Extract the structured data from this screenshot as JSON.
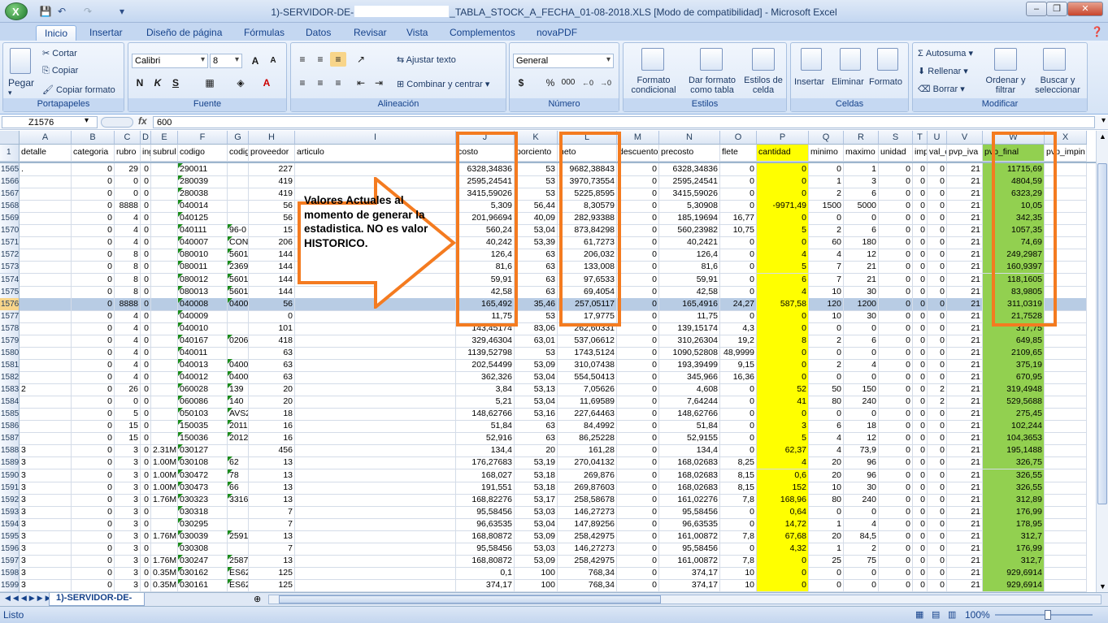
{
  "window": {
    "title_prefix": "1)-SERVIDOR-DE-",
    "title_suffix": "_TABLA_STOCK_A_FECHA_01-08-2018.XLS  [Modo de compatibilidad] - Microsoft Excel",
    "logo_letter": "X"
  },
  "ribbon_tabs": [
    "Inicio",
    "Insertar",
    "Diseño de página",
    "Fórmulas",
    "Datos",
    "Revisar",
    "Vista",
    "Complementos",
    "novaPDF"
  ],
  "ribbon": {
    "paste": "Pegar",
    "cut": "Cortar",
    "copy": "Copiar",
    "copy_format": "Copiar formato",
    "clipboard": "Portapapeles",
    "font_name": "Calibri",
    "font_size": "8",
    "font_group": "Fuente",
    "bold": "N",
    "italic": "K",
    "underline": "S",
    "align_group": "Alineación",
    "wrap_text": "Ajustar texto",
    "merge_center": "Combinar y centrar",
    "number_format": "General",
    "number_group": "Número",
    "currency": "$",
    "percent": "%",
    "thousands": "000",
    "cond_format": "Formato condicional",
    "table_format": "Dar formato como tabla",
    "cell_styles": "Estilos de celda",
    "styles_group": "Estilos",
    "insert": "Insertar",
    "delete": "Eliminar",
    "format": "Formato",
    "cells_group": "Celdas",
    "autosum": "Autosuma",
    "fill": "Rellenar",
    "clear": "Borrar",
    "sort_filter": "Ordenar y filtrar",
    "find_select": "Buscar y seleccionar",
    "modify_group": "Modificar"
  },
  "formula_bar": {
    "name_box": "Z1576",
    "fx": "fx",
    "value": "600"
  },
  "columns": [
    {
      "letter": "A",
      "header": "detalle"
    },
    {
      "letter": "B",
      "header": "categoria"
    },
    {
      "letter": "C",
      "header": "rubro"
    },
    {
      "letter": "D",
      "header": "ing"
    },
    {
      "letter": "E",
      "header": "subrul"
    },
    {
      "letter": "F",
      "header": "codigo"
    },
    {
      "letter": "G",
      "header": "codig"
    },
    {
      "letter": "H",
      "header": "proveedor"
    },
    {
      "letter": "I",
      "header": "articulo"
    },
    {
      "letter": "J",
      "header": "costo"
    },
    {
      "letter": "K",
      "header": "porciento"
    },
    {
      "letter": "L",
      "header": "neto"
    },
    {
      "letter": "M",
      "header": "descuento"
    },
    {
      "letter": "N",
      "header": "precosto"
    },
    {
      "letter": "O",
      "header": "flete"
    },
    {
      "letter": "P",
      "header": "cantidad"
    },
    {
      "letter": "Q",
      "header": "minimo"
    },
    {
      "letter": "R",
      "header": "maximo"
    },
    {
      "letter": "S",
      "header": "unidad"
    },
    {
      "letter": "T",
      "header": "imp"
    },
    {
      "letter": "U",
      "header": "val_c"
    },
    {
      "letter": "V",
      "header": "pvp_iva"
    },
    {
      "letter": "W",
      "header": "pvp_final"
    },
    {
      "letter": "X",
      "header": "pvp_impin"
    }
  ],
  "header_row_number": "1",
  "rows": [
    {
      "n": "1565",
      "A": ".",
      "B": "0",
      "C": "29",
      "D": "0",
      "E": "",
      "F": "290011",
      "G": "",
      "H": "227",
      "J": "6328,34836",
      "K": "53",
      "L": "9682,38843",
      "M": "0",
      "N": "6328,34836",
      "O": "0",
      "P": "0",
      "Q": "0",
      "R": "1",
      "S": "0",
      "T": "0",
      "U": "0",
      "V": "21",
      "W": "11715,69"
    },
    {
      "n": "1566",
      "A": "",
      "B": "0",
      "C": "0",
      "D": "0",
      "E": "",
      "F": "280039",
      "G": "",
      "H": "419",
      "J": "2595,24541",
      "K": "53",
      "L": "3970,73554",
      "M": "0",
      "N": "2595,24541",
      "O": "0",
      "P": "0",
      "Q": "1",
      "R": "3",
      "S": "0",
      "T": "0",
      "U": "0",
      "V": "21",
      "W": "4804,59"
    },
    {
      "n": "1567",
      "A": "",
      "B": "0",
      "C": "0",
      "D": "0",
      "E": "",
      "F": "280038",
      "G": "",
      "H": "419",
      "J": "3415,59026",
      "K": "53",
      "L": "5225,8595",
      "M": "0",
      "N": "3415,59026",
      "O": "0",
      "P": "0",
      "Q": "2",
      "R": "6",
      "S": "0",
      "T": "0",
      "U": "0",
      "V": "21",
      "W": "6323,29"
    },
    {
      "n": "1568",
      "A": "",
      "B": "0",
      "C": "8888",
      "D": "0",
      "E": "",
      "F": "040014",
      "G": "",
      "H": "56",
      "J": "5,309",
      "K": "56,44",
      "L": "8,30579",
      "M": "0",
      "N": "5,30908",
      "O": "0",
      "P": "-9971,49",
      "Q": "1500",
      "R": "5000",
      "S": "0",
      "T": "0",
      "U": "0",
      "V": "21",
      "W": "10,05"
    },
    {
      "n": "1569",
      "A": "",
      "B": "0",
      "C": "4",
      "D": "0",
      "E": "",
      "F": "040125",
      "G": "",
      "H": "56",
      "J": "201,96694",
      "K": "40,09",
      "L": "282,93388",
      "M": "0",
      "N": "185,19694",
      "O": "16,77",
      "P": "0",
      "Q": "0",
      "R": "0",
      "S": "0",
      "T": "0",
      "U": "0",
      "V": "21",
      "W": "342,35"
    },
    {
      "n": "1570",
      "A": "",
      "B": "0",
      "C": "4",
      "D": "0",
      "E": "",
      "F": "040111",
      "G": "96-0",
      "H": "15",
      "J": "560,24",
      "K": "53,04",
      "L": "873,84298",
      "M": "0",
      "N": "560,23982",
      "O": "10,75",
      "P": "5",
      "Q": "2",
      "R": "6",
      "S": "0",
      "T": "0",
      "U": "0",
      "V": "21",
      "W": "1057,35"
    },
    {
      "n": "1571",
      "A": "",
      "B": "0",
      "C": "4",
      "D": "0",
      "E": "",
      "F": "040007",
      "G": "CONS",
      "H": "206",
      "J": "40,242",
      "K": "53,39",
      "L": "61,7273",
      "M": "0",
      "N": "40,2421",
      "O": "0",
      "P": "0",
      "Q": "60",
      "R": "180",
      "S": "0",
      "T": "0",
      "U": "0",
      "V": "21",
      "W": "74,69"
    },
    {
      "n": "1572",
      "A": "",
      "B": "0",
      "C": "8",
      "D": "0",
      "E": "",
      "F": "080010",
      "G": "5601",
      "H": "144",
      "J": "126,4",
      "K": "63",
      "L": "206,032",
      "M": "0",
      "N": "126,4",
      "O": "0",
      "P": "4",
      "Q": "4",
      "R": "12",
      "S": "0",
      "T": "0",
      "U": "0",
      "V": "21",
      "W": "249,2987"
    },
    {
      "n": "1573",
      "A": "",
      "B": "0",
      "C": "8",
      "D": "0",
      "E": "",
      "F": "080011",
      "G": "2369",
      "H": "144",
      "J": "81,6",
      "K": "63",
      "L": "133,008",
      "M": "0",
      "N": "81,6",
      "O": "0",
      "P": "5",
      "Q": "7",
      "R": "21",
      "S": "0",
      "T": "0",
      "U": "0",
      "V": "21",
      "W": "160,9397"
    },
    {
      "n": "1574",
      "A": "",
      "B": "0",
      "C": "8",
      "D": "0",
      "E": "",
      "F": "080012",
      "G": "5601",
      "H": "144",
      "J": "59,91",
      "K": "63",
      "L": "97,6533",
      "M": "0",
      "N": "59,91",
      "O": "0",
      "P": "6",
      "Q": "7",
      "R": "21",
      "S": "0",
      "T": "0",
      "U": "0",
      "V": "21",
      "W": "118,1605"
    },
    {
      "n": "1575",
      "A": "",
      "B": "0",
      "C": "8",
      "D": "0",
      "E": "",
      "F": "080013",
      "G": "5601",
      "H": "144",
      "J": "42,58",
      "K": "63",
      "L": "69,4054",
      "M": "0",
      "N": "42,58",
      "O": "0",
      "P": "4",
      "Q": "10",
      "R": "30",
      "S": "0",
      "T": "0",
      "U": "0",
      "V": "21",
      "W": "83,9805"
    },
    {
      "n": "1576",
      "A": "",
      "B": "0",
      "C": "8888",
      "D": "0",
      "E": "",
      "F": "040008",
      "G": "0400",
      "H": "56",
      "J": "165,492",
      "K": "35,46",
      "L": "257,05117",
      "M": "0",
      "N": "165,4916",
      "O": "24,27",
      "P": "587,58",
      "Q": "120",
      "R": "1200",
      "S": "0",
      "T": "0",
      "U": "0",
      "V": "21",
      "W": "311,0319",
      "sel": true
    },
    {
      "n": "1577",
      "A": "",
      "B": "0",
      "C": "4",
      "D": "0",
      "E": "",
      "F": "040009",
      "G": "",
      "H": "0",
      "J": "11,75",
      "K": "53",
      "L": "17,9775",
      "M": "0",
      "N": "11,75",
      "O": "0",
      "P": "0",
      "Q": "10",
      "R": "30",
      "S": "0",
      "T": "0",
      "U": "0",
      "V": "21",
      "W": "21,7528"
    },
    {
      "n": "1578",
      "A": "",
      "B": "0",
      "C": "4",
      "D": "0",
      "E": "",
      "F": "040010",
      "G": "",
      "H": "101",
      "J": "143,45174",
      "K": "83,06",
      "L": "262,60331",
      "M": "0",
      "N": "139,15174",
      "O": "4,3",
      "P": "0",
      "Q": "0",
      "R": "0",
      "S": "0",
      "T": "0",
      "U": "0",
      "V": "21",
      "W": "317,75"
    },
    {
      "n": "1579",
      "A": "",
      "B": "0",
      "C": "4",
      "D": "0",
      "E": "",
      "F": "040167",
      "G": "0206",
      "H": "418",
      "J": "329,46304",
      "K": "63,01",
      "L": "537,06612",
      "M": "0",
      "N": "310,26304",
      "O": "19,2",
      "P": "8",
      "Q": "2",
      "R": "6",
      "S": "0",
      "T": "0",
      "U": "0",
      "V": "21",
      "W": "649,85"
    },
    {
      "n": "1580",
      "A": "",
      "B": "0",
      "C": "4",
      "D": "0",
      "E": "",
      "F": "040011",
      "G": "",
      "H": "63",
      "J": "1139,52798",
      "K": "53",
      "L": "1743,5124",
      "M": "0",
      "N": "1090,52808",
      "O": "48,9999",
      "P": "0",
      "Q": "0",
      "R": "0",
      "S": "0",
      "T": "0",
      "U": "0",
      "V": "21",
      "W": "2109,65"
    },
    {
      "n": "1581",
      "A": "",
      "B": "0",
      "C": "4",
      "D": "0",
      "E": "",
      "F": "040013",
      "G": "0400",
      "H": "63",
      "J": "202,54499",
      "K": "53,09",
      "L": "310,07438",
      "M": "0",
      "N": "193,39499",
      "O": "9,15",
      "P": "0",
      "Q": "2",
      "R": "4",
      "S": "0",
      "T": "0",
      "U": "0",
      "V": "21",
      "W": "375,19"
    },
    {
      "n": "1582",
      "A": "",
      "B": "0",
      "C": "4",
      "D": "0",
      "E": "",
      "F": "040012",
      "G": "0400",
      "H": "63",
      "J": "362,326",
      "K": "53,04",
      "L": "554,50413",
      "M": "0",
      "N": "345,966",
      "O": "16,36",
      "P": "0",
      "Q": "0",
      "R": "0",
      "S": "0",
      "T": "0",
      "U": "0",
      "V": "21",
      "W": "670,95"
    },
    {
      "n": "1583",
      "A": "2",
      "B": "0",
      "C": "26",
      "D": "0",
      "E": "",
      "F": "060028",
      "G": "139",
      "H": "20",
      "J": "3,84",
      "K": "53,13",
      "L": "7,05626",
      "M": "0",
      "N": "4,608",
      "O": "0",
      "P": "52",
      "Q": "50",
      "R": "150",
      "S": "0",
      "T": "0",
      "U": "2",
      "V": "21",
      "W": "319,4948"
    },
    {
      "n": "1584",
      "A": "",
      "B": "0",
      "C": "0",
      "D": "0",
      "E": "",
      "F": "060086",
      "G": "140",
      "H": "20",
      "J": "5,21",
      "K": "53,04",
      "L": "11,69589",
      "M": "0",
      "N": "7,64244",
      "O": "0",
      "P": "41",
      "Q": "80",
      "R": "240",
      "S": "0",
      "T": "0",
      "U": "2",
      "V": "21",
      "W": "529,5688"
    },
    {
      "n": "1585",
      "A": "",
      "B": "0",
      "C": "5",
      "D": "0",
      "E": "",
      "F": "050103",
      "G": "AVS2",
      "H": "18",
      "J": "148,62766",
      "K": "53,16",
      "L": "227,64463",
      "M": "0",
      "N": "148,62766",
      "O": "0",
      "P": "0",
      "Q": "0",
      "R": "0",
      "S": "0",
      "T": "0",
      "U": "0",
      "V": "21",
      "W": "275,45"
    },
    {
      "n": "1586",
      "A": "",
      "B": "0",
      "C": "15",
      "D": "0",
      "E": "",
      "F": "150035",
      "G": "2011",
      "H": "16",
      "J": "51,84",
      "K": "63",
      "L": "84,4992",
      "M": "0",
      "N": "51,84",
      "O": "0",
      "P": "3",
      "Q": "6",
      "R": "18",
      "S": "0",
      "T": "0",
      "U": "0",
      "V": "21",
      "W": "102,244"
    },
    {
      "n": "1587",
      "A": "",
      "B": "0",
      "C": "15",
      "D": "0",
      "E": "",
      "F": "150036",
      "G": "2012",
      "H": "16",
      "J": "52,916",
      "K": "63",
      "L": "86,25228",
      "M": "0",
      "N": "52,9155",
      "O": "0",
      "P": "5",
      "Q": "4",
      "R": "12",
      "S": "0",
      "T": "0",
      "U": "0",
      "V": "21",
      "W": "104,3653"
    },
    {
      "n": "1588",
      "A": "3",
      "B": "0",
      "C": "3",
      "D": "0",
      "E": "2.31M",
      "F": "030127",
      "G": "",
      "H": "456",
      "J": "134,4",
      "K": "20",
      "L": "161,28",
      "M": "0",
      "N": "134,4",
      "O": "0",
      "P": "62,37",
      "Q": "4",
      "R": "73,9",
      "S": "0",
      "T": "0",
      "U": "0",
      "V": "21",
      "W": "195,1488"
    },
    {
      "n": "1589",
      "A": "3",
      "B": "0",
      "C": "3",
      "D": "0",
      "E": "1.00M",
      "F": "030108",
      "G": "62",
      "H": "13",
      "J": "176,27683",
      "K": "53,19",
      "L": "270,04132",
      "M": "0",
      "N": "168,02683",
      "O": "8,25",
      "P": "4",
      "Q": "20",
      "R": "96",
      "S": "0",
      "T": "0",
      "U": "0",
      "V": "21",
      "W": "326,75"
    },
    {
      "n": "1590",
      "A": "3",
      "B": "0",
      "C": "3",
      "D": "0",
      "E": "1.00M",
      "F": "030472",
      "G": "78",
      "H": "13",
      "J": "168,027",
      "K": "53,18",
      "L": "269,876",
      "M": "0",
      "N": "168,02683",
      "O": "8,15",
      "P": "0,6",
      "Q": "20",
      "R": "96",
      "S": "0",
      "T": "0",
      "U": "0",
      "V": "21",
      "W": "326,55"
    },
    {
      "n": "1591",
      "A": "3",
      "B": "0",
      "C": "3",
      "D": "0",
      "E": "1.00M",
      "F": "030473",
      "G": "66",
      "H": "13",
      "J": "191,551",
      "K": "53,18",
      "L": "269,87603",
      "M": "0",
      "N": "168,02683",
      "O": "8,15",
      "P": "152",
      "Q": "10",
      "R": "30",
      "S": "0",
      "T": "0",
      "U": "0",
      "V": "21",
      "W": "326,55"
    },
    {
      "n": "1592",
      "A": "3",
      "B": "0",
      "C": "3",
      "D": "0",
      "E": "1.76M",
      "F": "030323",
      "G": "3316",
      "H": "13",
      "J": "168,82276",
      "K": "53,17",
      "L": "258,58678",
      "M": "0",
      "N": "161,02276",
      "O": "7,8",
      "P": "168,96",
      "Q": "80",
      "R": "240",
      "S": "0",
      "T": "0",
      "U": "0",
      "V": "21",
      "W": "312,89"
    },
    {
      "n": "1593",
      "A": "3",
      "B": "0",
      "C": "3",
      "D": "0",
      "E": "",
      "F": "030318",
      "G": "",
      "H": "7",
      "J": "95,58456",
      "K": "53,03",
      "L": "146,27273",
      "M": "0",
      "N": "95,58456",
      "O": "0",
      "P": "0,64",
      "Q": "0",
      "R": "0",
      "S": "0",
      "T": "0",
      "U": "0",
      "V": "21",
      "W": "176,99"
    },
    {
      "n": "1594",
      "A": "3",
      "B": "0",
      "C": "3",
      "D": "0",
      "E": "",
      "F": "030295",
      "G": "",
      "H": "7",
      "J": "96,63535",
      "K": "53,04",
      "L": "147,89256",
      "M": "0",
      "N": "96,63535",
      "O": "0",
      "P": "14,72",
      "Q": "1",
      "R": "4",
      "S": "0",
      "T": "0",
      "U": "0",
      "V": "21",
      "W": "178,95"
    },
    {
      "n": "1595",
      "A": "3",
      "B": "0",
      "C": "3",
      "D": "0",
      "E": "1.76M",
      "F": "030039",
      "G": "2591",
      "H": "13",
      "J": "168,80872",
      "K": "53,09",
      "L": "258,42975",
      "M": "0",
      "N": "161,00872",
      "O": "7,8",
      "P": "67,68",
      "Q": "20",
      "R": "84,5",
      "S": "0",
      "T": "0",
      "U": "0",
      "V": "21",
      "W": "312,7"
    },
    {
      "n": "1596",
      "A": "3",
      "B": "0",
      "C": "3",
      "D": "0",
      "E": "",
      "F": "030308",
      "G": "",
      "H": "7",
      "J": "95,58456",
      "K": "53,03",
      "L": "146,27273",
      "M": "0",
      "N": "95,58456",
      "O": "0",
      "P": "4,32",
      "Q": "1",
      "R": "2",
      "S": "0",
      "T": "0",
      "U": "0",
      "V": "21",
      "W": "176,99"
    },
    {
      "n": "1597",
      "A": "3",
      "B": "0",
      "C": "3",
      "D": "0",
      "E": "1.76M",
      "F": "030247",
      "G": "2587",
      "H": "13",
      "J": "168,80872",
      "K": "53,09",
      "L": "258,42975",
      "M": "0",
      "N": "161,00872",
      "O": "7,8",
      "P": "0",
      "Q": "25",
      "R": "75",
      "S": "0",
      "T": "0",
      "U": "0",
      "V": "21",
      "W": "312,7"
    },
    {
      "n": "1598",
      "A": "3",
      "B": "0",
      "C": "3",
      "D": "0",
      "E": "0.35M",
      "F": "030162",
      "G": "ES62",
      "H": "125",
      "J": "0,1",
      "K": "100",
      "L": "768,34",
      "M": "0",
      "N": "374,17",
      "O": "10",
      "P": "0",
      "Q": "0",
      "R": "0",
      "S": "0",
      "T": "0",
      "U": "0",
      "V": "21",
      "W": "929,6914"
    },
    {
      "n": "1599",
      "A": "3",
      "B": "0",
      "C": "3",
      "D": "0",
      "E": "0.35M",
      "F": "030161",
      "G": "ES62",
      "H": "125",
      "J": "374,17",
      "K": "100",
      "L": "768,34",
      "M": "0",
      "N": "374,17",
      "O": "10",
      "P": "0",
      "Q": "0",
      "R": "0",
      "S": "0",
      "T": "0",
      "U": "0",
      "V": "21",
      "W": "929,6914"
    }
  ],
  "callout": {
    "text": "Valores Actuales al momento de generar la estadistica. NO es valor HISTORICO."
  },
  "highlight_color": "#f47b20",
  "yellow": "#ffff00",
  "green": "#92d050",
  "sheet_tab": "1)-SERVIDOR-DE-",
  "status": {
    "ready": "Listo",
    "zoom": "100%"
  }
}
